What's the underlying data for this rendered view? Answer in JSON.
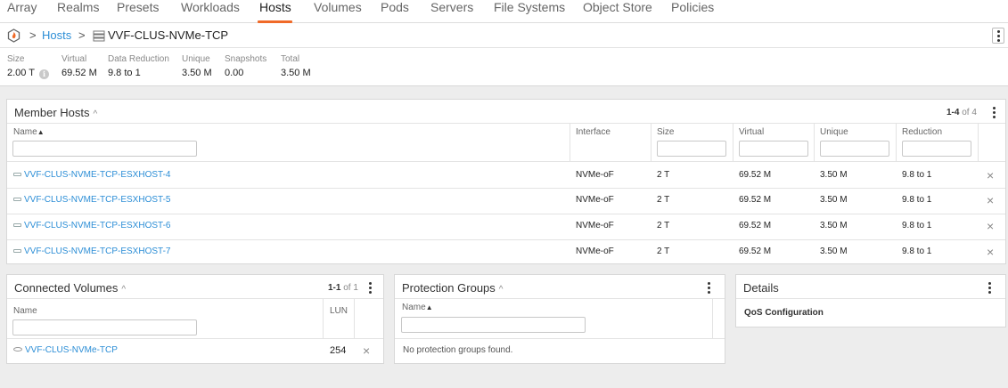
{
  "nav": {
    "tabs": [
      "Array",
      "Realms",
      "Presets",
      "Workloads",
      "Hosts",
      "Volumes",
      "Pods",
      "Servers",
      "File Systems",
      "Object Store",
      "Policies"
    ],
    "active_tab": "Hosts",
    "accent_color": "#f06a28"
  },
  "breadcrumb": {
    "sep1": ">",
    "hosts_link": "Hosts",
    "sep2": ">",
    "current": "VVF-CLUS-NVMe-TCP",
    "logo_icon": "flame-logo-icon",
    "item_icon": "hostgroup-icon"
  },
  "stats": {
    "labels": [
      "Size",
      "Virtual",
      "Data Reduction",
      "Unique",
      "Snapshots",
      "Total"
    ],
    "values": [
      "2.00 T",
      "69.52 M",
      "9.8 to 1",
      "3.50 M",
      "0.00",
      "3.50 M"
    ]
  },
  "member_hosts": {
    "title": "Member Hosts",
    "pager_range": "1-4",
    "pager_total": "of 4",
    "columns": [
      "Name",
      "Interface",
      "Size",
      "Virtual",
      "Unique",
      "Reduction"
    ],
    "rows": [
      {
        "name": "VVF-CLUS-NVME-TCP-ESXHOST-4",
        "interface": "NVMe-oF",
        "size": "2 T",
        "virtual": "69.52 M",
        "unique": "3.50 M",
        "reduction": "9.8 to 1"
      },
      {
        "name": "VVF-CLUS-NVME-TCP-ESXHOST-5",
        "interface": "NVMe-oF",
        "size": "2 T",
        "virtual": "69.52 M",
        "unique": "3.50 M",
        "reduction": "9.8 to 1"
      },
      {
        "name": "VVF-CLUS-NVME-TCP-ESXHOST-6",
        "interface": "NVMe-oF",
        "size": "2 T",
        "virtual": "69.52 M",
        "unique": "3.50 M",
        "reduction": "9.8 to 1"
      },
      {
        "name": "VVF-CLUS-NVME-TCP-ESXHOST-7",
        "interface": "NVMe-oF",
        "size": "2 T",
        "virtual": "69.52 M",
        "unique": "3.50 M",
        "reduction": "9.8 to 1"
      }
    ]
  },
  "connected_volumes": {
    "title": "Connected Volumes",
    "pager_range": "1-1",
    "pager_total": "of 1",
    "columns": [
      "Name",
      "LUN"
    ],
    "rows": [
      {
        "name": "VVF-CLUS-NVMe-TCP",
        "lun": "254"
      }
    ]
  },
  "protection_groups": {
    "title": "Protection Groups",
    "columns": [
      "Name"
    ],
    "empty_text": "No protection groups found."
  },
  "details": {
    "title": "Details",
    "qos_label": "QoS Configuration"
  },
  "symbols": {
    "chevron": "^",
    "sort_asc": "▲",
    "close": "×",
    "info": "i"
  }
}
